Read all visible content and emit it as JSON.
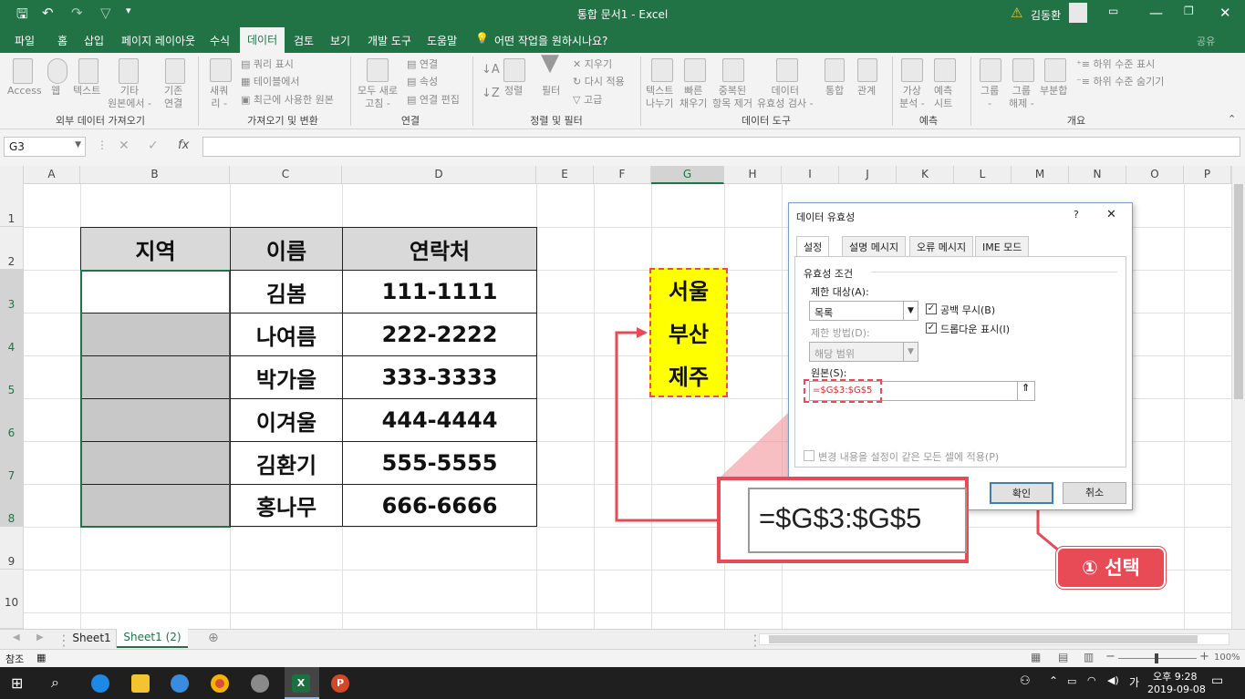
{
  "window": {
    "title": "통합 문서1  -  Excel",
    "user": "김동환",
    "share": "공유",
    "tell_me": "어떤 작업을 원하시나요?"
  },
  "menu": [
    "파일",
    "홈",
    "삽입",
    "페이지 레이아웃",
    "수식",
    "데이터",
    "검토",
    "보기",
    "개발 도구",
    "도움말"
  ],
  "ribbon": {
    "groups": [
      "외부 데이터 가져오기",
      "가져오기 및 변환",
      "연결",
      "정렬 및 필터",
      "데이터 도구",
      "예측",
      "개요"
    ],
    "ext": [
      "Access",
      "웹",
      "텍스트",
      "기타\n원본에서 -",
      "기존\n연결"
    ],
    "transform": {
      "new_query": "새쿼\n리 -",
      "items": [
        "쿼리 표시",
        "테이블에서",
        "최근에 사용한 원본"
      ]
    },
    "conn": {
      "refresh": "모두 새로\n고침 -",
      "items": [
        "연결",
        "속성",
        "연결 편집"
      ]
    },
    "sort": {
      "sort": "정렬",
      "filter": "필터",
      "items": [
        "지우기",
        "다시 적용",
        "고급"
      ]
    },
    "tools": [
      "텍스트\n나누기",
      "빠른\n채우기",
      "중복된\n항목 제거",
      "데이터\n유효성 검사 -",
      "통합",
      "관계"
    ],
    "forecast": [
      "가상\n분석 -",
      "예측\n시트"
    ],
    "outline": {
      "buttons": [
        "그룹\n-",
        "그룹\n해제 -",
        "부분합"
      ],
      "items": [
        "하위 수준 표시",
        "하위 수준 숨기기"
      ]
    }
  },
  "formula_bar": {
    "name_box": "G3",
    "fx": "fx",
    "value": ""
  },
  "columns": [
    "A",
    "B",
    "C",
    "D",
    "E",
    "F",
    "G",
    "H",
    "I",
    "J",
    "K",
    "L",
    "M",
    "N",
    "O",
    "P"
  ],
  "rows": [
    "1",
    "2",
    "3",
    "4",
    "5",
    "6",
    "7",
    "8",
    "9",
    "10"
  ],
  "table": {
    "headers": [
      "지역",
      "이름",
      "연락처"
    ],
    "names": [
      "김봄",
      "나여름",
      "박가을",
      "이겨울",
      "김환기",
      "홍나무"
    ],
    "phones": [
      "111-1111",
      "222-2222",
      "333-3333",
      "444-4444",
      "555-5555",
      "666-6666"
    ]
  },
  "source_list": [
    "서울",
    "부산",
    "제주"
  ],
  "dialog": {
    "title": "데이터 유효성",
    "help": "?",
    "close": "✕",
    "tabs": [
      "설정",
      "설명 메시지",
      "오류 메시지",
      "IME 모드"
    ],
    "criteria": "유효성 조건",
    "allow_label": "제한 대상(A):",
    "allow_value": "목록",
    "ignore_blank": "공백 무시(B)",
    "dropdown": "드롭다운 표시(I)",
    "data_label": "제한 방법(D):",
    "data_value": "해당 범위",
    "source_label": "원본(S):",
    "source_value": "=$G$3:$G$5",
    "apply_all": "변경 내용을 설정이 같은 모든 셀에 적용(P)",
    "ok": "확인",
    "cancel": "취소"
  },
  "callout": {
    "zoom_text": "=$G$3:$G$5",
    "step": "① 선택"
  },
  "sheets": [
    "Sheet1",
    "Sheet1 (2)"
  ],
  "status": {
    "mode": "참조",
    "zoom": "100%"
  },
  "taskbar": {
    "time": "오후 9:28",
    "date": "2019-09-08",
    "ime": "가"
  },
  "colors": {
    "excel_green": "#217346",
    "callout_red": "#e84b55",
    "highlight": "#ffff00"
  }
}
